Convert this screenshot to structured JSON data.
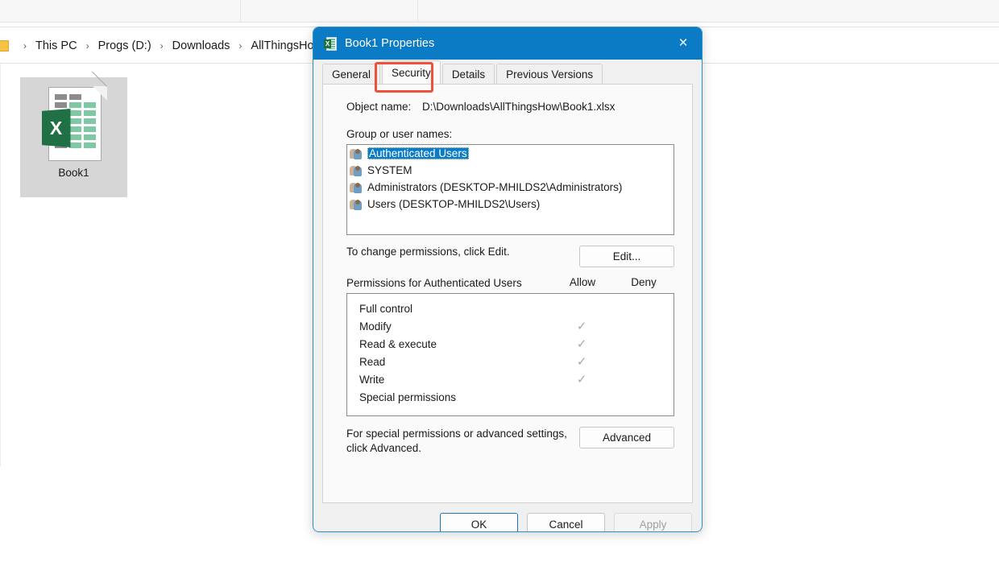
{
  "explorer": {
    "breadcrumb": {
      "folder_icon": "folder-icon",
      "items": [
        "This PC",
        "Progs (D:)",
        "Downloads",
        "AllThingsHow"
      ],
      "separator": "›"
    },
    "file_tile": {
      "icon": "excel-file-icon",
      "x_glyph": "X",
      "label": "Book1"
    }
  },
  "dialog": {
    "title": "Book1 Properties",
    "title_icon": "excel-icon",
    "title_x_glyph": "X",
    "close_icon": "×",
    "accent_color": "#0a7bc4",
    "highlight_color": "#f0503c",
    "tabs": [
      {
        "label": "General",
        "active": false
      },
      {
        "label": "Security",
        "active": true
      },
      {
        "label": "Details",
        "active": false
      },
      {
        "label": "Previous Versions",
        "active": false
      }
    ],
    "object_name": {
      "label": "Object name:",
      "value": "D:\\Downloads\\AllThingsHow\\Book1.xlsx"
    },
    "group_users": {
      "label": "Group or user names:",
      "rows": [
        {
          "name": "Authenticated Users",
          "selected": true
        },
        {
          "name": "SYSTEM",
          "selected": false
        },
        {
          "name": "Administrators (DESKTOP-MHILDS2\\Administrators)",
          "selected": false
        },
        {
          "name": "Users (DESKTOP-MHILDS2\\Users)",
          "selected": false
        }
      ]
    },
    "edit_hint": "To change permissions, click Edit.",
    "edit_button": "Edit...",
    "permissions": {
      "title": "Permissions for Authenticated Users",
      "allow_header": "Allow",
      "deny_header": "Deny",
      "check_glyph": "✓",
      "rows": [
        {
          "name": "Full control",
          "allow": false,
          "deny": false
        },
        {
          "name": "Modify",
          "allow": true,
          "deny": false
        },
        {
          "name": "Read & execute",
          "allow": true,
          "deny": false
        },
        {
          "name": "Read",
          "allow": true,
          "deny": false
        },
        {
          "name": "Write",
          "allow": true,
          "deny": false
        },
        {
          "name": "Special permissions",
          "allow": false,
          "deny": false
        }
      ]
    },
    "advanced_hint": "For special permissions or advanced settings, click Advanced.",
    "advanced_button": "Advanced",
    "footer": {
      "ok": "OK",
      "cancel": "Cancel",
      "apply": "Apply"
    }
  }
}
